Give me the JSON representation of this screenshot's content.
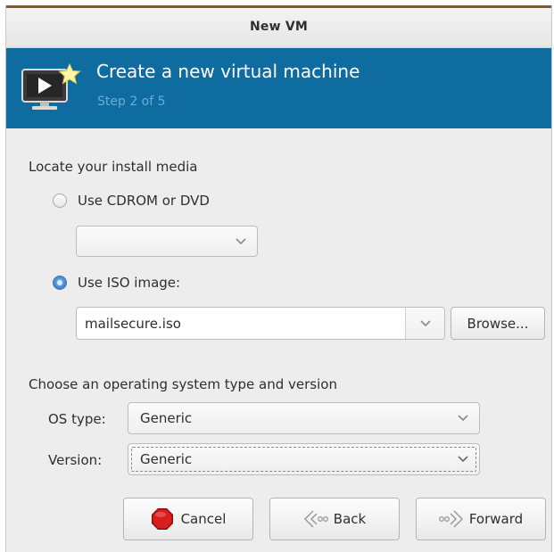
{
  "window": {
    "title": "New VM"
  },
  "banner": {
    "title": "Create a new virtual machine",
    "step": "Step 2 of 5"
  },
  "install_media": {
    "section_label": "Locate your install media",
    "cdrom_label": "Use CDROM or DVD",
    "cdrom_selected": false,
    "cdrom_value": "",
    "iso_label": "Use ISO image:",
    "iso_selected": true,
    "iso_value": "mailsecure.iso",
    "browse_label": "Browse..."
  },
  "os": {
    "section_label": "Choose an operating system type and version",
    "type_label": "OS type:",
    "type_value": "Generic",
    "version_label": "Version:",
    "version_value": "Generic"
  },
  "buttons": {
    "cancel": "Cancel",
    "back": "Back",
    "forward": "Forward"
  },
  "colors": {
    "banner": "#0e6ca1",
    "step_text": "#6aaed6",
    "cancel_icon": "#d81e1e"
  }
}
